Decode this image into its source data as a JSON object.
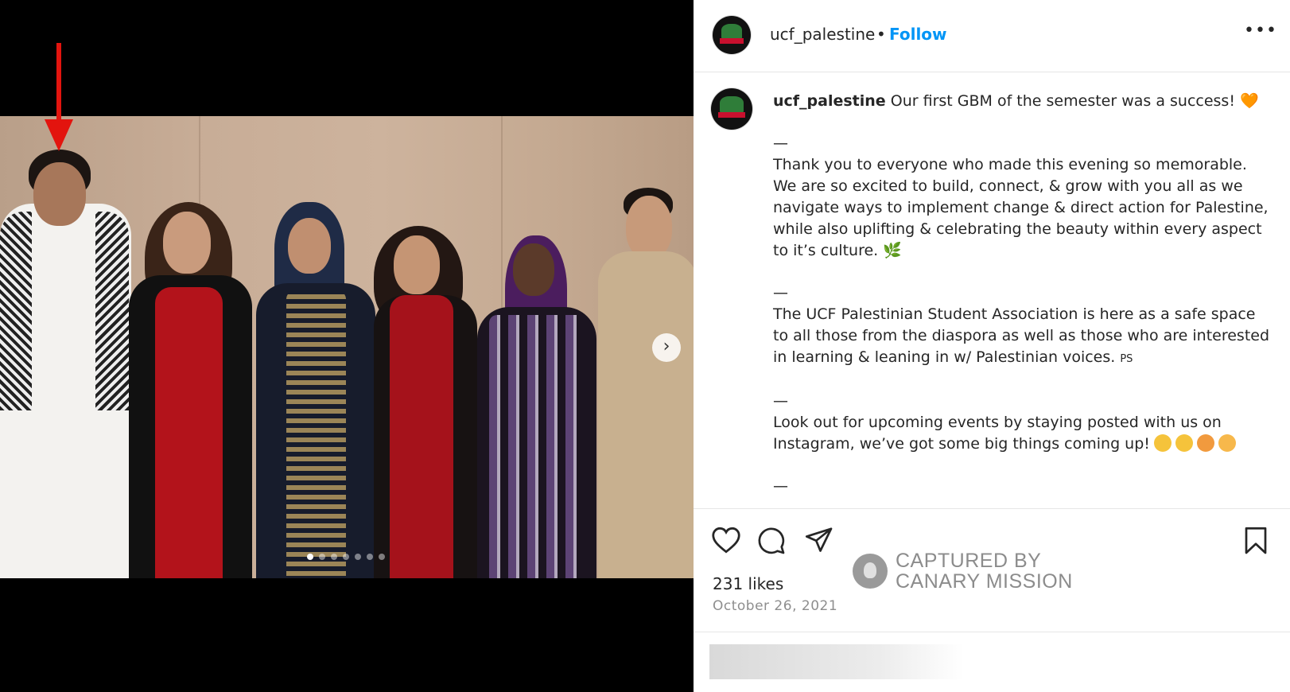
{
  "post": {
    "username": "ucf_palestine",
    "separator": "•",
    "follow_label": "Follow",
    "more_label": "•••"
  },
  "caption": {
    "username": "ucf_palestine",
    "intro": "Our first GBM of the semester was a success!",
    "intro_emoji": "🧡",
    "dash": "—",
    "para1": [
      "Thank you to everyone who made this evening so memorable.",
      "We are so excited to build, connect, & grow with you all as we",
      "navigate ways to implement change & direct action for Palestine,",
      "while also uplifting & celebrating the beauty within every aspect",
      "to it’s culture."
    ],
    "para1_emoji": "🌿",
    "para2": [
      "The UCF Palestinian Student Association is here as a safe space",
      "to all those from the diaspora as well as those who are interested",
      "in learning & leaning in w/ Palestinian voices."
    ],
    "para2_suffix": "PS",
    "para3": [
      "Look out for upcoming events by staying posted with us on",
      "Instagram, we’ve got some big things coming up!"
    ]
  },
  "engagement": {
    "likes": "231 likes",
    "date": "October 26, 2021"
  },
  "watermark": {
    "line1": "CAPTURED BY",
    "line2": "CANARY MISSION"
  },
  "media": {
    "carousel_count": 7,
    "carousel_active_index": 0,
    "next_icon": "›"
  },
  "colors": {
    "follow": "#0095f6",
    "arrow": "#e3140e",
    "text": "#262626",
    "muted": "#8e8e8e"
  },
  "icons": [
    "heart-icon",
    "comment-icon",
    "share-icon",
    "bookmark-icon",
    "more-options-icon",
    "chevron-right-icon"
  ]
}
